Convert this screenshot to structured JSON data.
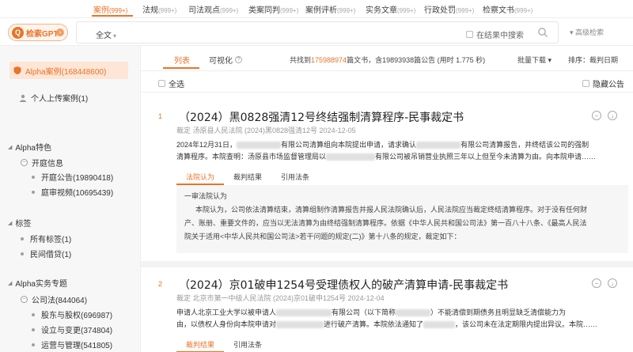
{
  "category_tabs": [
    {
      "label": "案例",
      "count": "(999+)"
    },
    {
      "label": "法规",
      "count": "(999+)"
    },
    {
      "label": "司法观点",
      "count": "(999+)"
    },
    {
      "label": "类案同判",
      "count": "(999+)"
    },
    {
      "label": "案例评析",
      "count": "(999+)"
    },
    {
      "label": "实务文章",
      "count": "(999+)"
    },
    {
      "label": "行政处罚",
      "count": "(999+)"
    },
    {
      "label": "检察文书",
      "count": "(999+)"
    }
  ],
  "search": {
    "gpt_label": "检索GPT",
    "scope": "全文",
    "in_result_label": "在结果中搜索",
    "advanced_label": "高级检索"
  },
  "sidebar": {
    "alpha_cases": "Alpha案例(168448600)",
    "personal_upload": "个人上传案例(1)",
    "section1": {
      "title": "Alpha特色",
      "group": "开庭信息",
      "items": [
        "开庭公告(19890418)",
        "庭审视频(10695439)"
      ]
    },
    "section2": {
      "title": "标签",
      "items": [
        "所有标签(1)",
        "民间借贷(1)"
      ]
    },
    "section3": {
      "title": "Alpha实务专题",
      "group": "公司法(844064)",
      "items": [
        "股东与股权(696987)",
        "设立与变更(374804)",
        "运营与管理(541805)"
      ]
    }
  },
  "main": {
    "view_list": "列表",
    "view_viz": "可视化",
    "summary": {
      "prefix": "共找到",
      "count": "175988974",
      "suffix": "篇文书，含19893938篇公告 (用时 1.775 秒)"
    },
    "batch_download": "批量下载",
    "sort_label": "排序：裁判日期",
    "select_all": "全选",
    "hide_announcements": "隐藏公告",
    "results": [
      {
        "num": "1",
        "title": "（2024）黑0828强清12号终结强制清算程序-民事裁定书",
        "meta": "裁定 汤原县人民法院 (2024)黑0828强清12号 2024-12-05",
        "body_line1_a": "2024年12月31日，",
        "body_line1_b": "有限公司清算组向本院提出申请，请求确认",
        "body_line1_c": "有限公司清算报告，并终结该公司的强制",
        "body_line2_a": "清算程序。本院查明：汤原县市场监督管理局以",
        "body_line2_b": "有限公司被吊销营业执照三年以上但至今未清算为由。向本院申请……",
        "tabs": [
          "法院认为",
          "裁判结果",
          "引用法条"
        ],
        "box_lines": [
          "一审法院认为",
          "本院认为，公司依法清算结束，清算组制作清算报告并报人民法院确认后，人民法院应当裁定终结清算程序。对于没有任何财",
          "产、账册、重要文件的，应当以无法清算为由终结强制清算程序。依据《中华人民共和国公司法》第一百八十八条、《最高人民法",
          "院关于适用<中华人民共和国公司法>若干问题的规定(二)》第十八条的规定，裁定如下："
        ]
      },
      {
        "num": "2",
        "title": "（2024）京01破申1254号受理债权人的破产清算申请-民事裁定书",
        "meta": "裁定 北京市第一中级人民法院 (2024)京01破申1254号 2024-12-04",
        "body_line1_a": "申请人北京工业大学以被申请人",
        "body_line1_b": "有限公司（以下简称",
        "body_line1_c": "）不能清偿到期债务且明显缺乏清偿能力为",
        "body_line2_a": "由，以债权人身份向本院申请对",
        "body_line2_b": "进行破产清算。本院依法通知了",
        "body_line2_c": "，该公司未在法定期限内提出异议。本院……",
        "tabs": [
          "裁判结果",
          "引用法条"
        ]
      }
    ]
  },
  "colors": {
    "accent": "#e8742a",
    "accent_light": "#fde6d6",
    "sidebar_bg": "#f7f7f8"
  }
}
